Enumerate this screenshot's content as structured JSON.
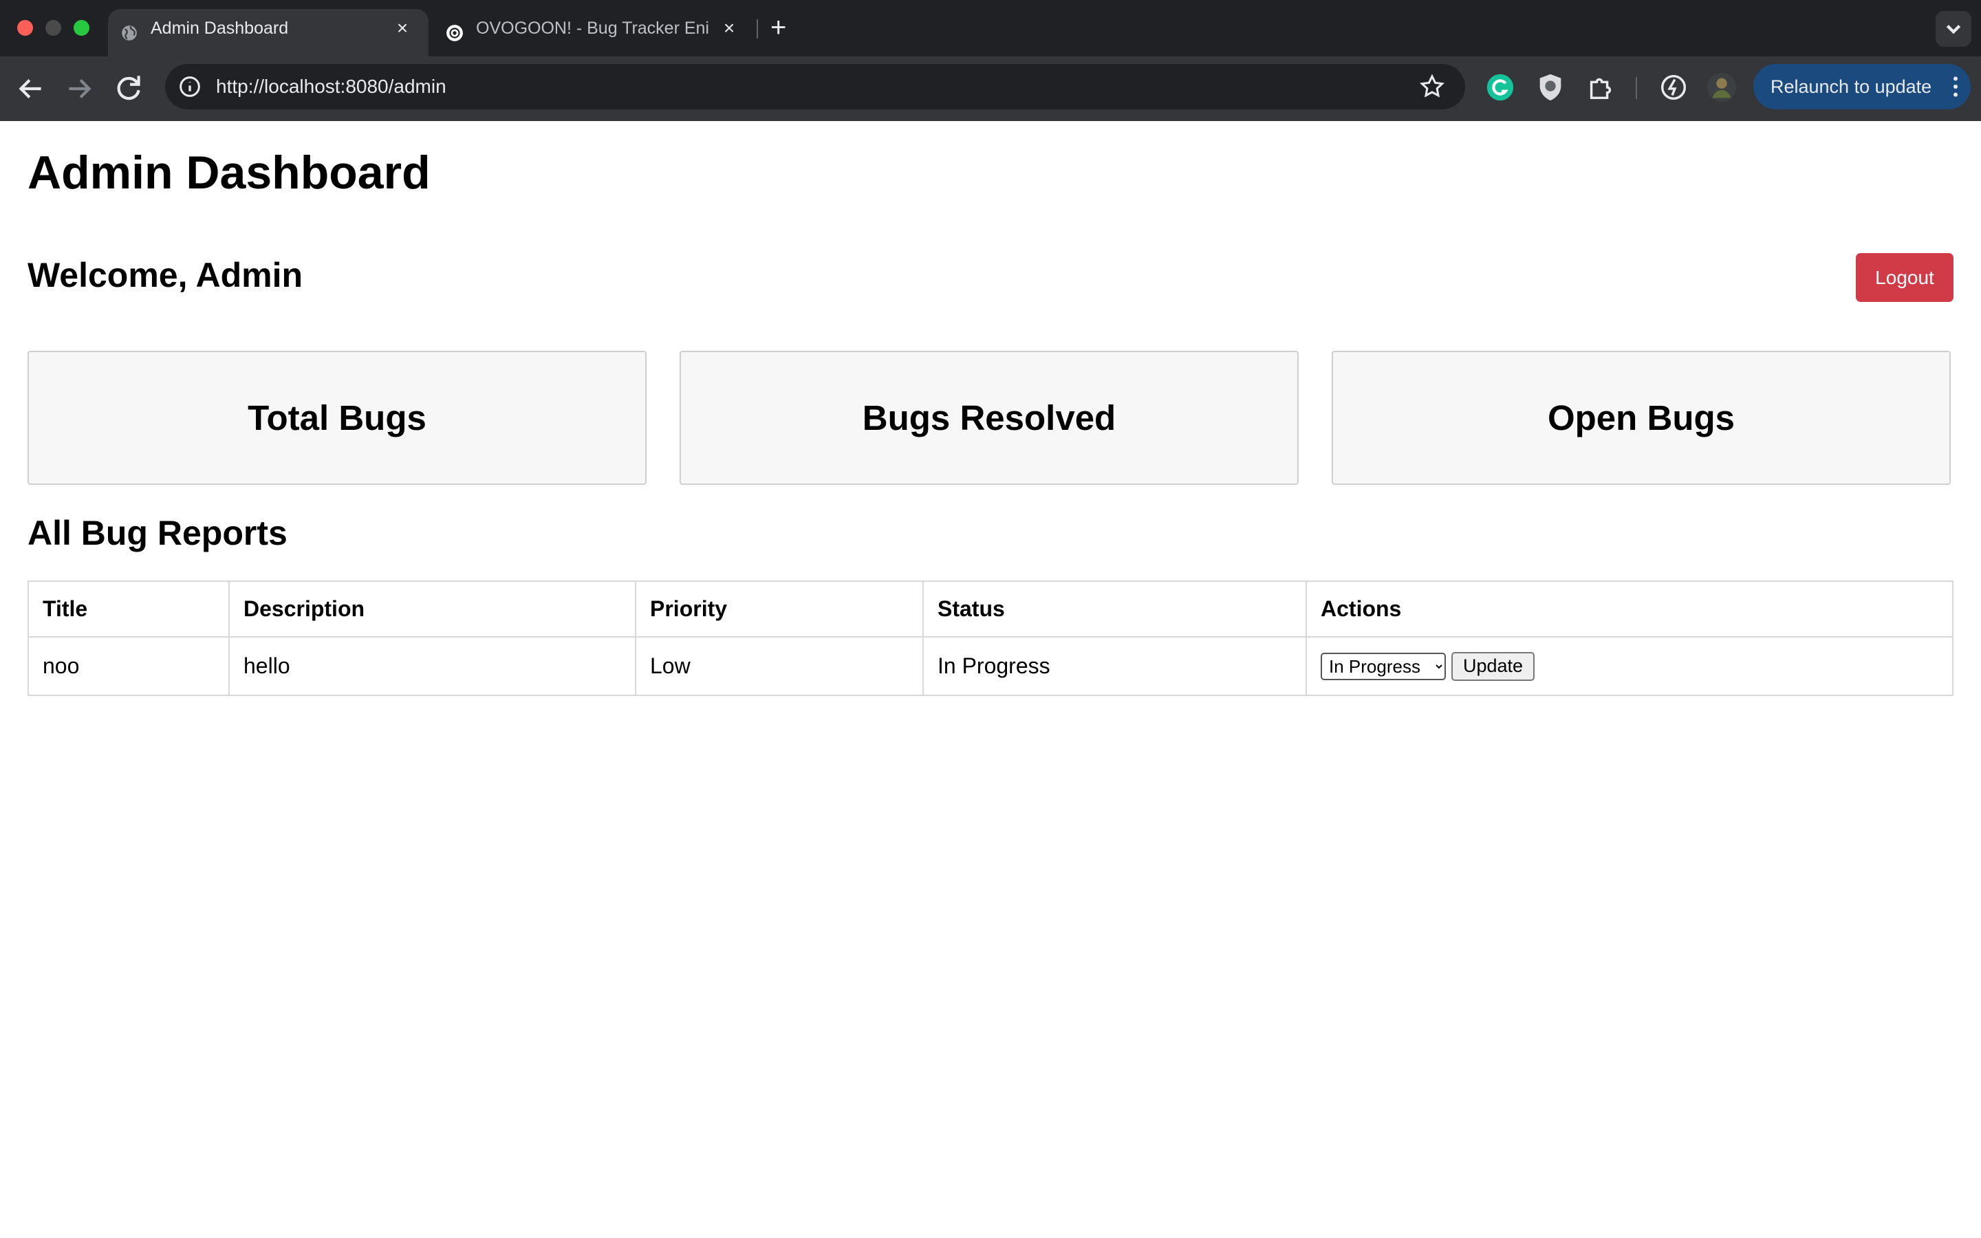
{
  "browser": {
    "tabs": [
      {
        "title": "Admin Dashboard",
        "active": true
      },
      {
        "title": "OVOGOON! - Bug Tracker Eni",
        "active": false
      }
    ],
    "new_tab_symbol": "+",
    "url": "http://localhost:8080/admin",
    "relaunch_label": "Relaunch to update",
    "icons": [
      "back-icon",
      "forward-icon",
      "reload-icon",
      "site-info-icon",
      "bookmark-star-icon",
      "grammarly-icon",
      "shield-extension-icon",
      "extensions-puzzle-icon",
      "performance-icon",
      "profile-avatar-icon",
      "kebab-menu-icon",
      "tab-search-chevron-icon"
    ]
  },
  "page": {
    "title": "Admin Dashboard",
    "welcome": "Welcome, Admin",
    "logout_label": "Logout",
    "cards": [
      {
        "label": "Total Bugs"
      },
      {
        "label": "Bugs Resolved"
      },
      {
        "label": "Open Bugs"
      }
    ],
    "reports_title": "All Bug Reports",
    "table": {
      "headers": [
        "Title",
        "Description",
        "Priority",
        "Status",
        "Actions"
      ],
      "rows": [
        {
          "title": "noo",
          "description": "hello",
          "priority": "Low",
          "status": "In Progress",
          "action_selected": "In Progress",
          "action_button": "Update"
        }
      ]
    }
  },
  "colors": {
    "logout": "#d13b48",
    "relaunch_bg": "#1a4a7e",
    "tabbar": "#202124",
    "toolbar": "#35363a"
  }
}
